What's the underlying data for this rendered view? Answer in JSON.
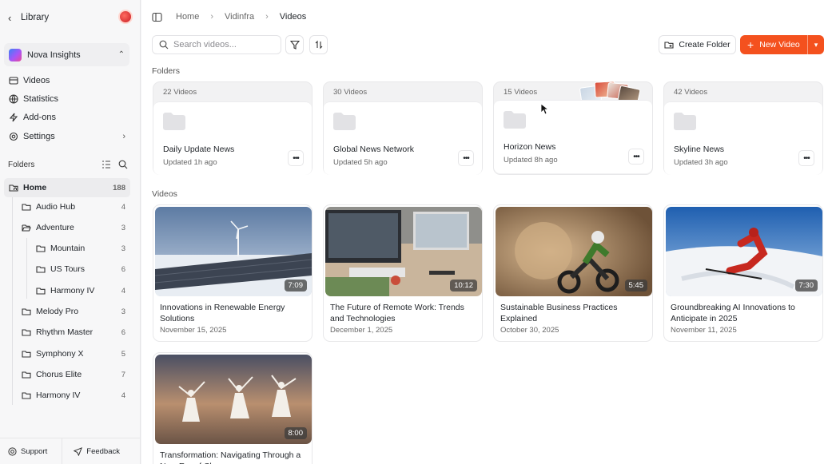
{
  "sidebar": {
    "back_label": "Library",
    "workspace": "Nova Insights",
    "nav": [
      {
        "label": "Videos",
        "icon": "video-icon"
      },
      {
        "label": "Statistics",
        "icon": "globe-icon"
      },
      {
        "label": "Add-ons",
        "icon": "bolt-icon"
      },
      {
        "label": "Settings",
        "icon": "gear-icon"
      }
    ],
    "folders_label": "Folders",
    "tree": [
      {
        "label": "Home",
        "count": "188"
      },
      {
        "label": "Audio Hub",
        "count": "4"
      },
      {
        "label": "Adventure",
        "count": "3"
      },
      {
        "label": "Mountain",
        "count": "3"
      },
      {
        "label": "US Tours",
        "count": "6"
      },
      {
        "label": "Harmony IV",
        "count": "4"
      },
      {
        "label": "Melody Pro",
        "count": "3"
      },
      {
        "label": "Rhythm Master",
        "count": "6"
      },
      {
        "label": "Symphony X",
        "count": "5"
      },
      {
        "label": "Chorus Elite",
        "count": "7"
      },
      {
        "label": "Harmony IV",
        "count": "4"
      }
    ],
    "support_label": "Support",
    "feedback_label": "Feedback"
  },
  "breadcrumb": [
    "Home",
    "Vidinfra",
    "Videos"
  ],
  "toolbar": {
    "search_placeholder": "Search videos...",
    "create_folder_label": "Create Folder",
    "new_video_label": "New Video",
    "accent_color": "#f4511e"
  },
  "folders_section": "Folders",
  "folders": [
    {
      "count": "22 Videos",
      "name": "Daily Update News",
      "updated": "Updated 1h ago"
    },
    {
      "count": "30 Videos",
      "name": "Global News Network",
      "updated": "Updated 5h ago"
    },
    {
      "count": "15 Videos",
      "name": "Horizon News",
      "updated": "Updated 8h ago"
    },
    {
      "count": "42 Videos",
      "name": "Skyline News",
      "updated": "Updated 3h ago"
    }
  ],
  "videos_section": "Videos",
  "videos": [
    {
      "title": "Innovations in Renewable Energy Solutions",
      "date": "November 15, 2025",
      "duration": "7:09"
    },
    {
      "title": "The Future of Remote Work: Trends and Technologies",
      "date": "December 1, 2025",
      "duration": "10:12"
    },
    {
      "title": "Sustainable Business Practices Explained",
      "date": "October 30, 2025",
      "duration": "5:45"
    },
    {
      "title": "Groundbreaking AI Innovations to Anticipate in 2025",
      "date": "November 11, 2025",
      "duration": "7:30"
    },
    {
      "title": "Transformation: Navigating Through a New Era of Change",
      "date": "",
      "duration": "8:00"
    }
  ]
}
